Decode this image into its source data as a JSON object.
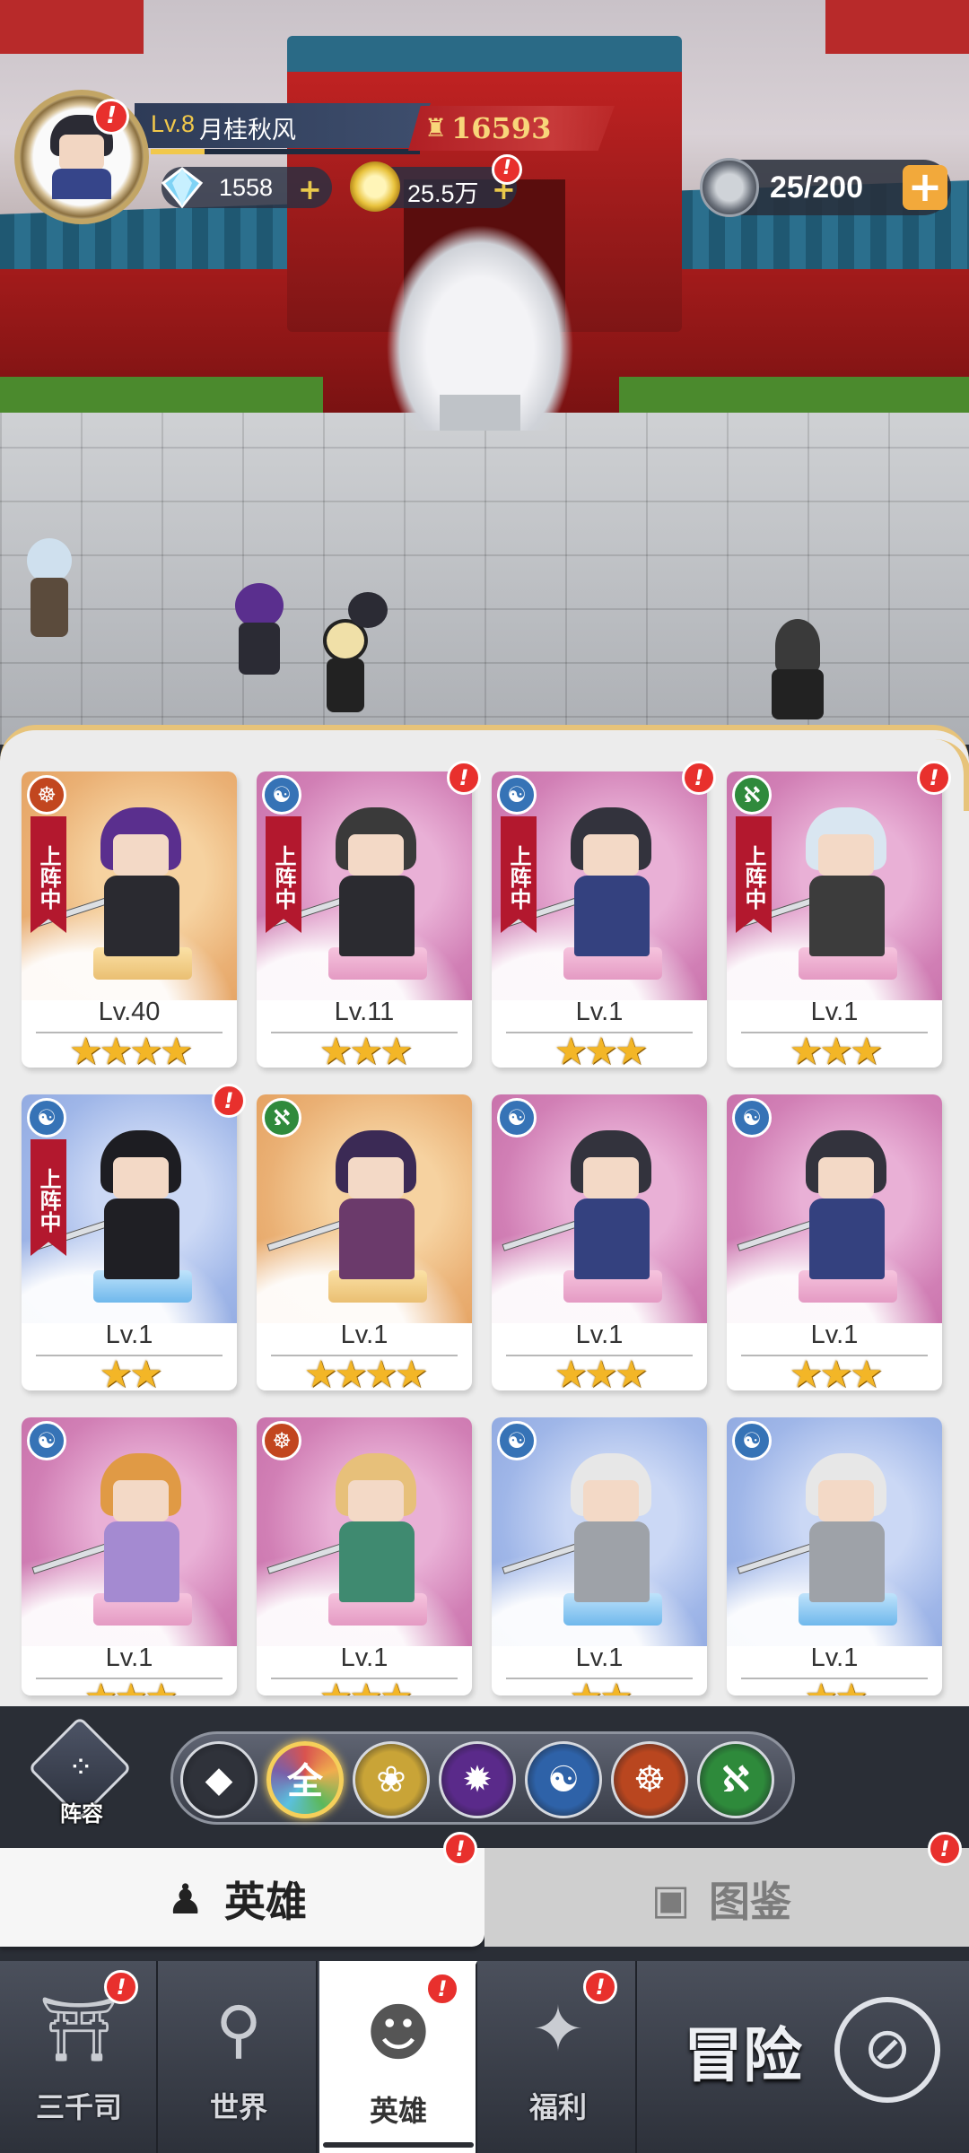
{
  "player": {
    "level": "Lv.8",
    "name": "月桂秋风",
    "power": "16593",
    "diamonds": "1558",
    "gold": "25.5万",
    "stamina": "25/200",
    "avatar_alert": "!",
    "gold_alert": "!"
  },
  "heroes": [
    {
      "level": "Lv.40",
      "stars": "★★★★",
      "faction": "fire",
      "faction_glyph": "☸",
      "deployed": "上阵中",
      "alert": ""
    },
    {
      "level": "Lv.11",
      "stars": "★★★",
      "faction": "water",
      "faction_glyph": "☯",
      "deployed": "上阵中",
      "alert": "!"
    },
    {
      "level": "Lv.1",
      "stars": "★★★",
      "faction": "water",
      "faction_glyph": "☯",
      "deployed": "上阵中",
      "alert": "!"
    },
    {
      "level": "Lv.1",
      "stars": "★★★",
      "faction": "wind",
      "faction_glyph": "ℵ",
      "deployed": "上阵中",
      "alert": "!"
    },
    {
      "level": "Lv.1",
      "stars": "★★",
      "faction": "water",
      "faction_glyph": "☯",
      "deployed": "上阵中",
      "alert": "!"
    },
    {
      "level": "Lv.1",
      "stars": "★★★★",
      "faction": "wind",
      "faction_glyph": "ℵ",
      "deployed": "",
      "alert": ""
    },
    {
      "level": "Lv.1",
      "stars": "★★★",
      "faction": "water",
      "faction_glyph": "☯",
      "deployed": "",
      "alert": ""
    },
    {
      "level": "Lv.1",
      "stars": "★★★",
      "faction": "water",
      "faction_glyph": "☯",
      "deployed": "",
      "alert": ""
    },
    {
      "level": "Lv.1",
      "stars": "★★★",
      "faction": "water",
      "faction_glyph": "☯",
      "deployed": "",
      "alert": ""
    },
    {
      "level": "Lv.1",
      "stars": "★★★",
      "faction": "fire",
      "faction_glyph": "☸",
      "deployed": "",
      "alert": ""
    },
    {
      "level": "Lv.1",
      "stars": "★★",
      "faction": "water",
      "faction_glyph": "☯",
      "deployed": "",
      "alert": ""
    },
    {
      "level": "Lv.1",
      "stars": "★★",
      "faction": "water",
      "faction_glyph": "☯",
      "deployed": "",
      "alert": ""
    }
  ],
  "lineup_label": "阵容",
  "filters": [
    {
      "name": "tank",
      "glyph": "◆",
      "color": "#2f323a"
    },
    {
      "name": "all",
      "glyph": "全",
      "color": "#7a5fa8"
    },
    {
      "name": "lotus",
      "glyph": "❀",
      "color": "#c9a437"
    },
    {
      "name": "flame",
      "glyph": "✹",
      "color": "#5a2a8a"
    },
    {
      "name": "water",
      "glyph": "☯",
      "color": "#2e62a8"
    },
    {
      "name": "fire",
      "glyph": "☸",
      "color": "#b9461f"
    },
    {
      "name": "wind",
      "glyph": "ℵ",
      "color": "#2e8a3b"
    }
  ],
  "tabs": {
    "heroes": "英雄",
    "codex": "图鉴"
  },
  "nav": {
    "items": [
      "三千司",
      "世界",
      "英雄",
      "福利"
    ],
    "adventure": "冒险"
  },
  "colors": {
    "accent_gold": "#f1c84b",
    "alert_red": "#e8302d",
    "deploy_red": "#b3182e"
  }
}
